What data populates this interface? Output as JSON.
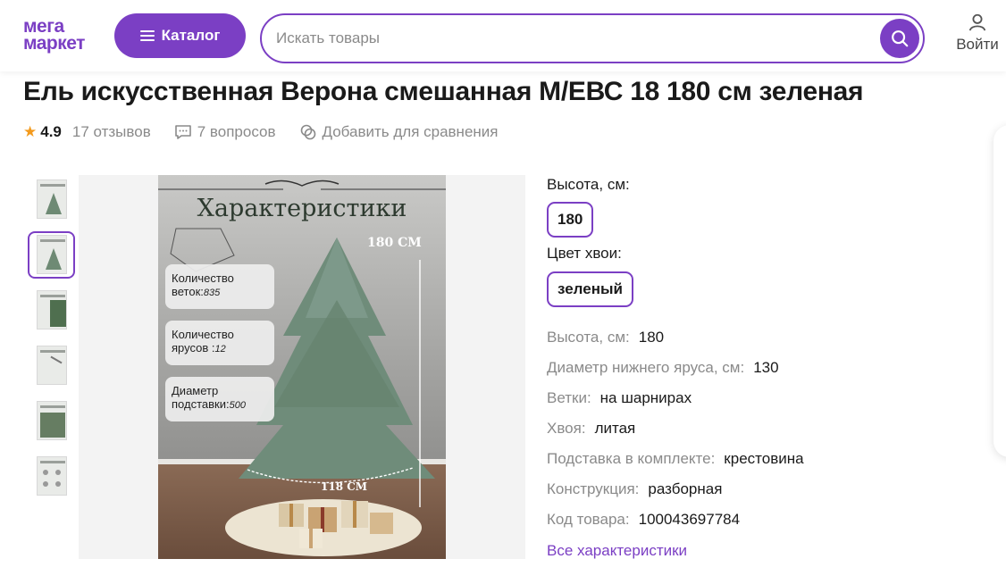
{
  "header": {
    "logo_line1": "мега",
    "logo_line2": "маркет",
    "catalog_label": "Каталог",
    "search_placeholder": "Искать товары",
    "login_label": "Войти"
  },
  "product": {
    "title": "Ель искусственная Верона смешанная М/ЕВС 18 180 см зеленая",
    "rating": "4.9",
    "reviews": "17 отзывов",
    "questions": "7 вопросов",
    "compare": "Добавить для сравнения"
  },
  "options": {
    "height_label": "Высота, см:",
    "height_value": "180",
    "color_label": "Цвет хвои:",
    "color_value": "зеленый"
  },
  "specs": [
    {
      "key": "Высота, см:",
      "value": "180"
    },
    {
      "key": "Диаметр нижнего яруса, см:",
      "value": "130"
    },
    {
      "key": "Ветки:",
      "value": "на шарнирах"
    },
    {
      "key": "Хвоя:",
      "value": "литая"
    },
    {
      "key": "Подставка в комплекте:",
      "value": "крестовина"
    },
    {
      "key": "Конструкция:",
      "value": "разборная"
    },
    {
      "key": "Код товара:",
      "value": "100043697784"
    }
  ],
  "all_specs_link": "Все характеристики",
  "image": {
    "heading": "Характеристики",
    "height_tag": "180 СМ",
    "base_tag": "118 СМ",
    "card1_line1": "Количество",
    "card1_line2": "веток:",
    "card1_value": "835",
    "card2_line1": "Количество",
    "card2_line2": "ярусов :",
    "card2_value": "12",
    "card3_line1": "Диаметр",
    "card3_line2": "подставки:",
    "card3_value": "500"
  },
  "colors": {
    "brand": "#7b3fc4",
    "muted_text": "#8a8a8a",
    "star": "#f39a1d"
  },
  "icons": [
    "search-icon",
    "user-icon",
    "star-icon",
    "chat-icon",
    "compare-icon",
    "menu-icon"
  ]
}
